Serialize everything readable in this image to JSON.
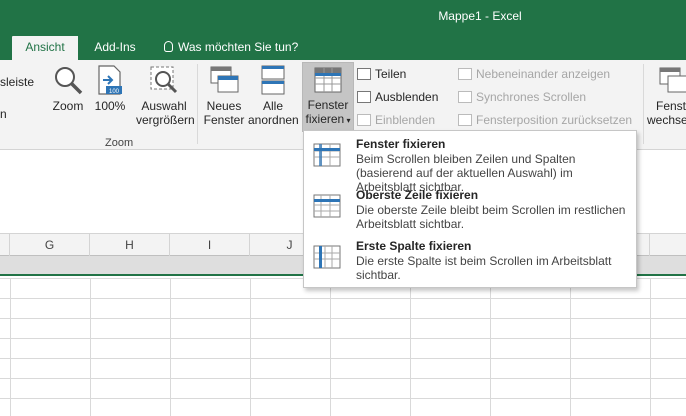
{
  "window": {
    "title": "Mappe1 - Excel"
  },
  "tabs": [
    {
      "label": "Ansicht",
      "active": true
    },
    {
      "label": "Add-Ins",
      "active": false
    }
  ],
  "tell_me": {
    "text": "Was möchten Sie tun?",
    "icon": "lightbulb-icon"
  },
  "ribbon": {
    "partial_left_top": "sleiste",
    "partial_left_bottom": "n",
    "zoom_group": {
      "label": "Zoom",
      "buttons": [
        {
          "line1": "Zoom",
          "line2": "",
          "icon": "magnifier-icon"
        },
        {
          "line1": "100%",
          "line2": "",
          "icon": "zoom-100-icon"
        },
        {
          "line1": "Auswahl",
          "line2": "vergrößern",
          "icon": "zoom-selection-icon"
        }
      ]
    },
    "window_group": {
      "buttons": [
        {
          "line1": "Neues",
          "line2": "Fenster",
          "icon": "new-window-icon"
        },
        {
          "line1": "Alle",
          "line2": "anordnen",
          "icon": "arrange-all-icon"
        },
        {
          "line1": "Fenster",
          "line2": "fixieren",
          "icon": "freeze-panes-icon",
          "pressed": true
        }
      ],
      "small_buttons": [
        {
          "label": "Teilen",
          "enabled": true
        },
        {
          "label": "Ausblenden",
          "enabled": true
        },
        {
          "label": "Einblenden",
          "enabled": false
        },
        {
          "label": "Nebeneinander anzeigen",
          "enabled": false
        },
        {
          "label": "Synchrones Scrollen",
          "enabled": false
        },
        {
          "label": "Fensterposition zurücksetzen",
          "enabled": false
        }
      ],
      "partial_right_top": "Fenst",
      "partial_right_bottom": "wechse"
    }
  },
  "freeze_menu": {
    "items": [
      {
        "title": "Fenster fixieren",
        "description": "Beim Scrollen bleiben Zeilen und Spalten (basierend auf der aktuellen Auswahl) im Arbeitsblatt sichtbar."
      },
      {
        "title": "Oberste Zeile fixieren",
        "description": "Die oberste Zeile bleibt beim Scrollen im restlichen Arbeitsblatt sichtbar."
      },
      {
        "title": "Erste Spalte fixieren",
        "description": "Die erste Spalte ist beim Scrollen im Arbeitsblatt sichtbar."
      }
    ]
  },
  "columns": [
    "G",
    "H",
    "I",
    "J"
  ],
  "colors": {
    "excel_green": "#217346",
    "ribbon_bg": "#f3f3f3",
    "pressed_bg": "#c5c5c5"
  }
}
